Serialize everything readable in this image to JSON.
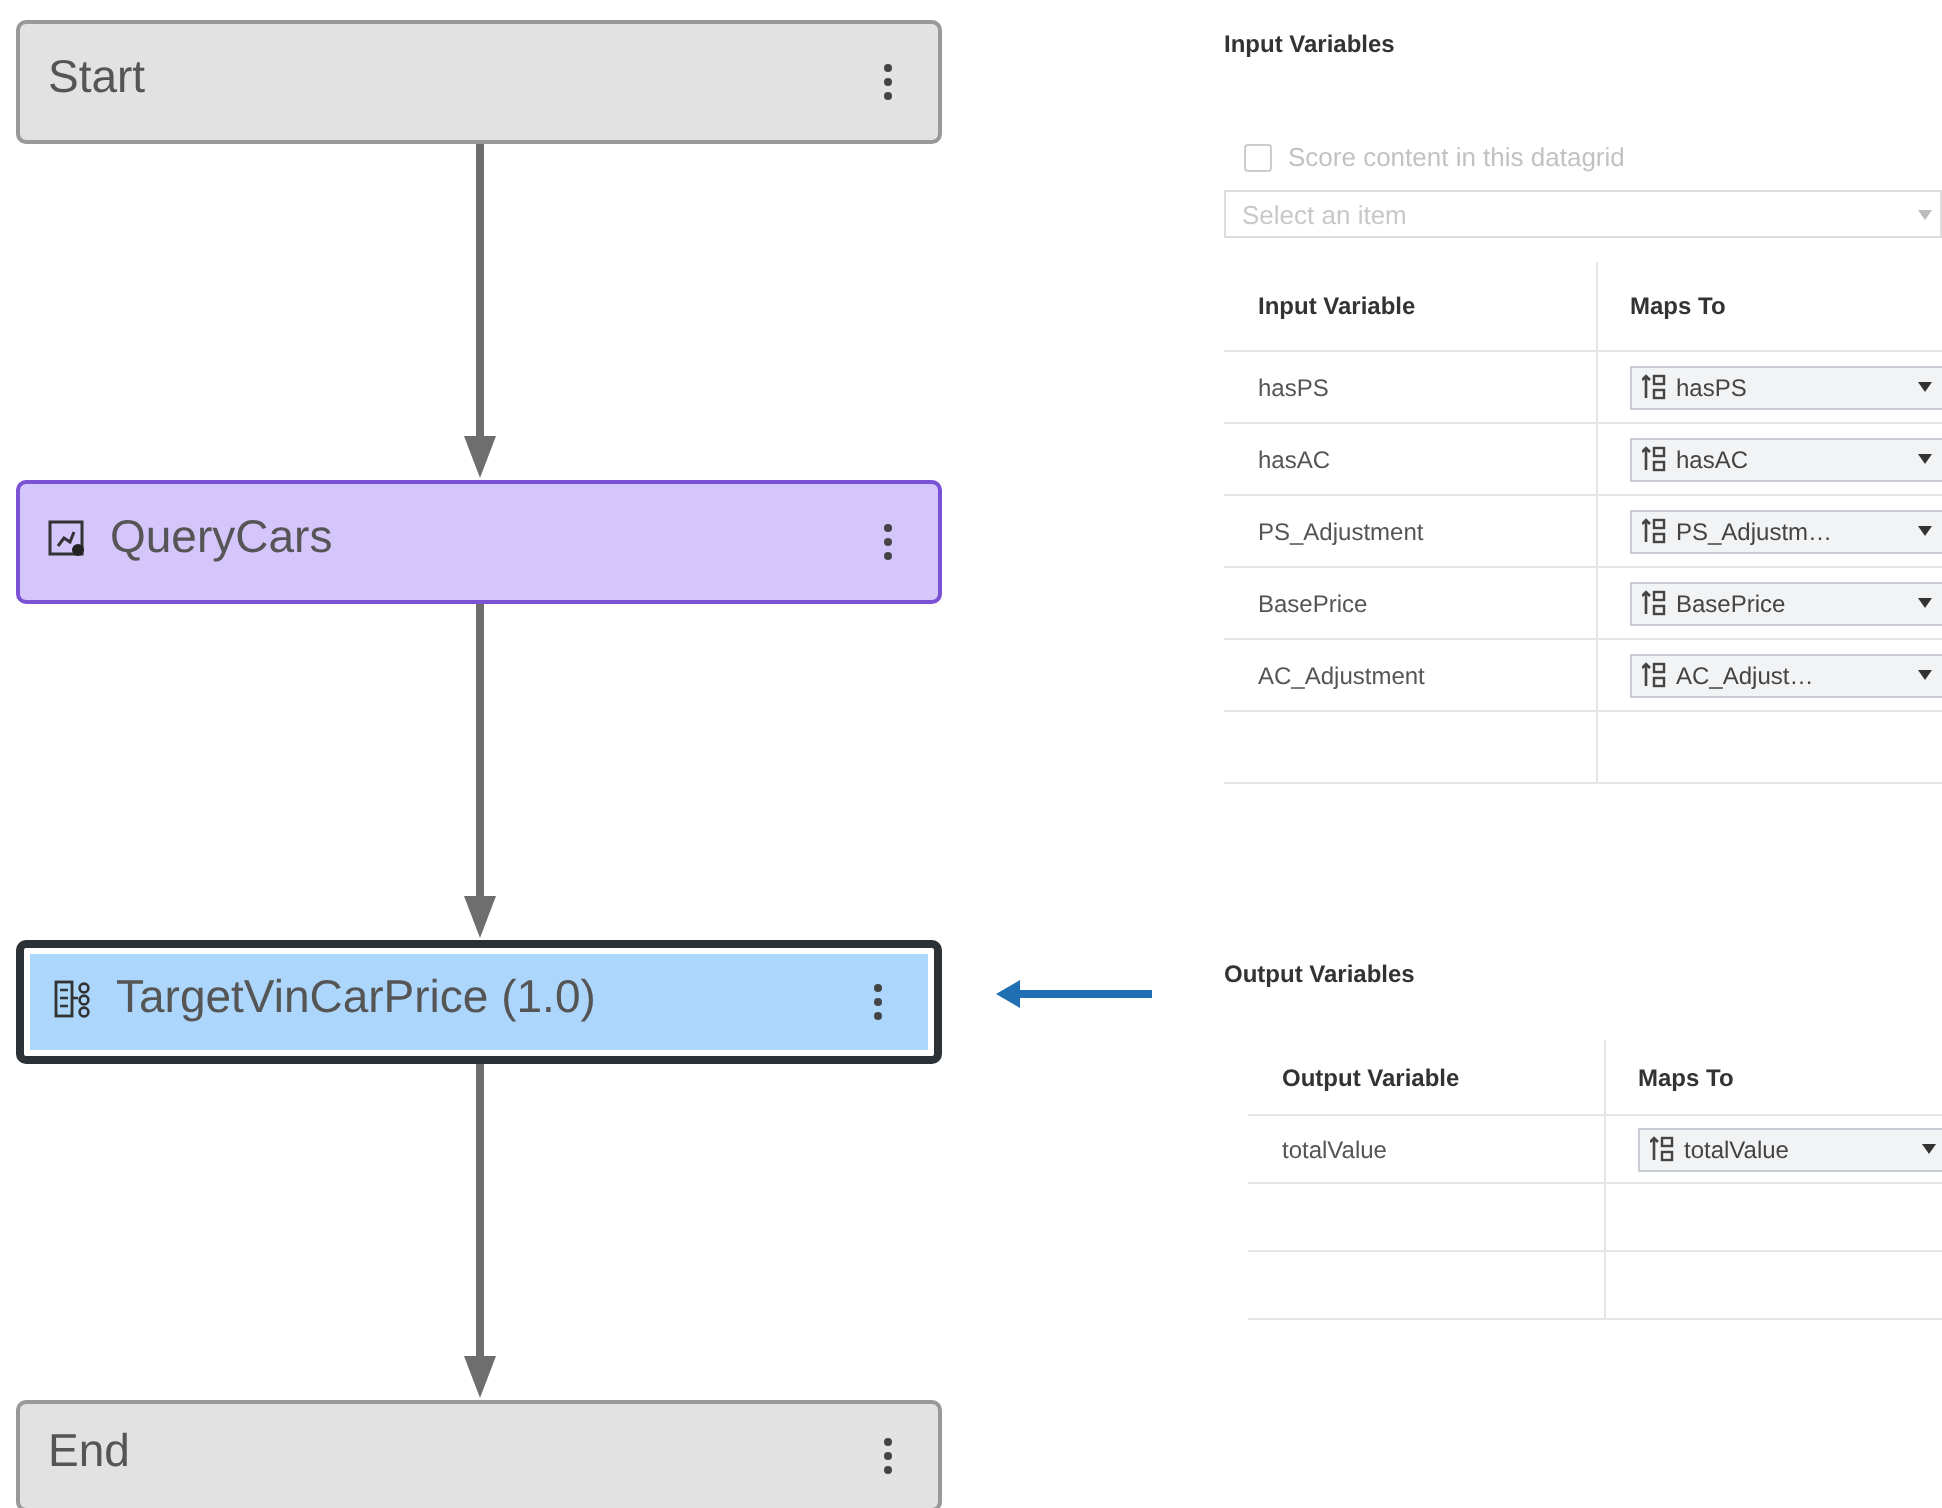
{
  "flow": {
    "nodes": [
      {
        "label": "Start",
        "kind": "terminal",
        "selected": false
      },
      {
        "label": "QueryCars",
        "kind": "query",
        "selected": false
      },
      {
        "label": "TargetVinCarPrice (1.0)",
        "kind": "model",
        "selected": true
      },
      {
        "label": "End",
        "kind": "terminal",
        "selected": false
      }
    ]
  },
  "input_variables": {
    "title": "Input Variables",
    "score_checkbox": {
      "label": "Score content in this datagrid",
      "checked": false,
      "disabled": true
    },
    "select": {
      "placeholder": "Select an item"
    },
    "columns": [
      "Input Variable",
      "Maps To"
    ],
    "rows": [
      {
        "variable": "hasPS",
        "maps_to": "hasPS"
      },
      {
        "variable": "hasAC",
        "maps_to": "hasAC"
      },
      {
        "variable": "PS_Adjustment",
        "maps_to": "PS_Adjustm…"
      },
      {
        "variable": "BasePrice",
        "maps_to": "BasePrice"
      },
      {
        "variable": "AC_Adjustment",
        "maps_to": "AC_Adjust…"
      }
    ]
  },
  "output_variables": {
    "title": "Output Variables",
    "columns": [
      "Output Variable",
      "Maps To"
    ],
    "rows": [
      {
        "variable": "totalValue",
        "maps_to": "totalValue"
      }
    ]
  }
}
